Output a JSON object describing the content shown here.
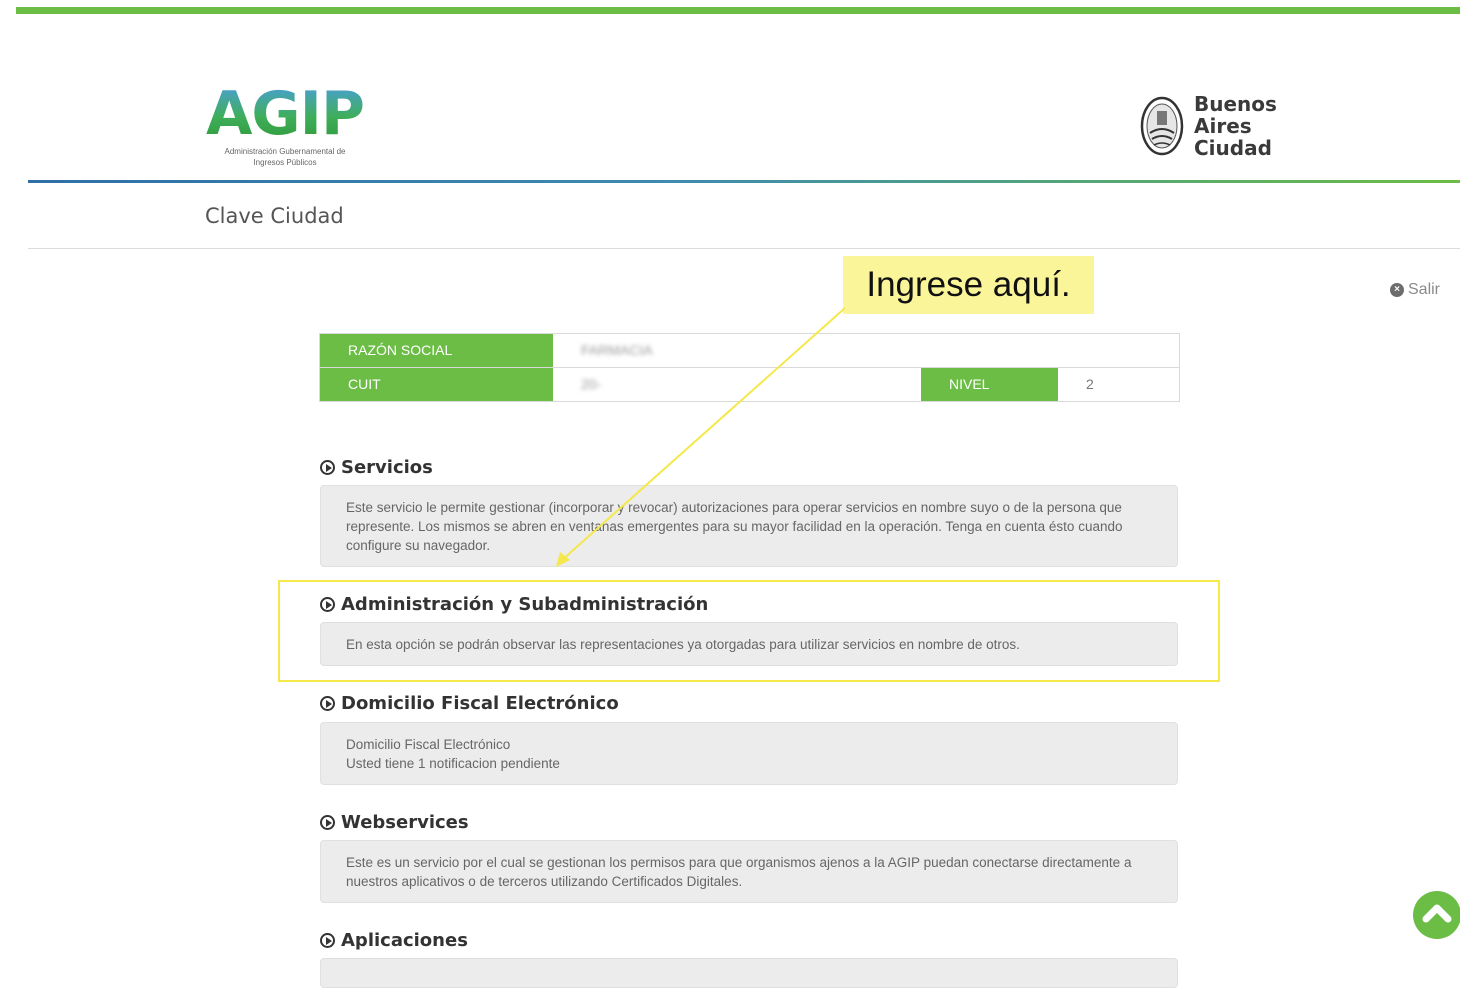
{
  "header": {
    "agip_logo_text": "AGIP",
    "agip_logo_subtitle": "Administración Gubernamental de Ingresos Públicos",
    "ba_logo_lines": [
      "Buenos",
      "Aires",
      "Ciudad"
    ]
  },
  "page_title": "Clave Ciudad",
  "salir_label": "Salir",
  "callout_text": "Ingrese aquí.",
  "info": {
    "razon_social_label": "RAZÓN SOCIAL",
    "razon_social_value": "FARMACIA",
    "cuit_label": "CUIT",
    "cuit_value": "20-",
    "nivel_label": "NIVEL",
    "nivel_value": "2"
  },
  "sections": [
    {
      "title": "Servicios",
      "text": "Este servicio le permite gestionar (incorporar y revocar) autorizaciones para operar servicios en nombre suyo o de la persona que represente. Los mismos se abren en ventanas emergentes para su mayor facilidad en la operación. Tenga en cuenta ésto cuando configure su navegador."
    },
    {
      "title": "Administración y Subadministración",
      "text": "En esta opción se podrán observar las representaciones ya otorgadas para utilizar servicios en nombre de otros."
    },
    {
      "title": "Domicilio Fiscal Electrónico",
      "line1": "Domicilio Fiscal Electrónico",
      "line2": "Usted tiene 1 notificacion pendiente"
    },
    {
      "title": "Webservices",
      "text": "Este es un servicio por el cual se gestionan los permisos para que organismos ajenos a la AGIP puedan conectarse directamente a nuestros aplicativos o de terceros utilizando Certificados Digitales."
    },
    {
      "title": "Aplicaciones"
    }
  ],
  "colors": {
    "brand_green": "#6bbd45",
    "callout_yellow": "#fbf59a",
    "highlight_yellow": "#f4e84a"
  },
  "icons": [
    "play-circle-icon",
    "close-circle-icon",
    "chevron-up-icon",
    "city-seal-icon"
  ]
}
